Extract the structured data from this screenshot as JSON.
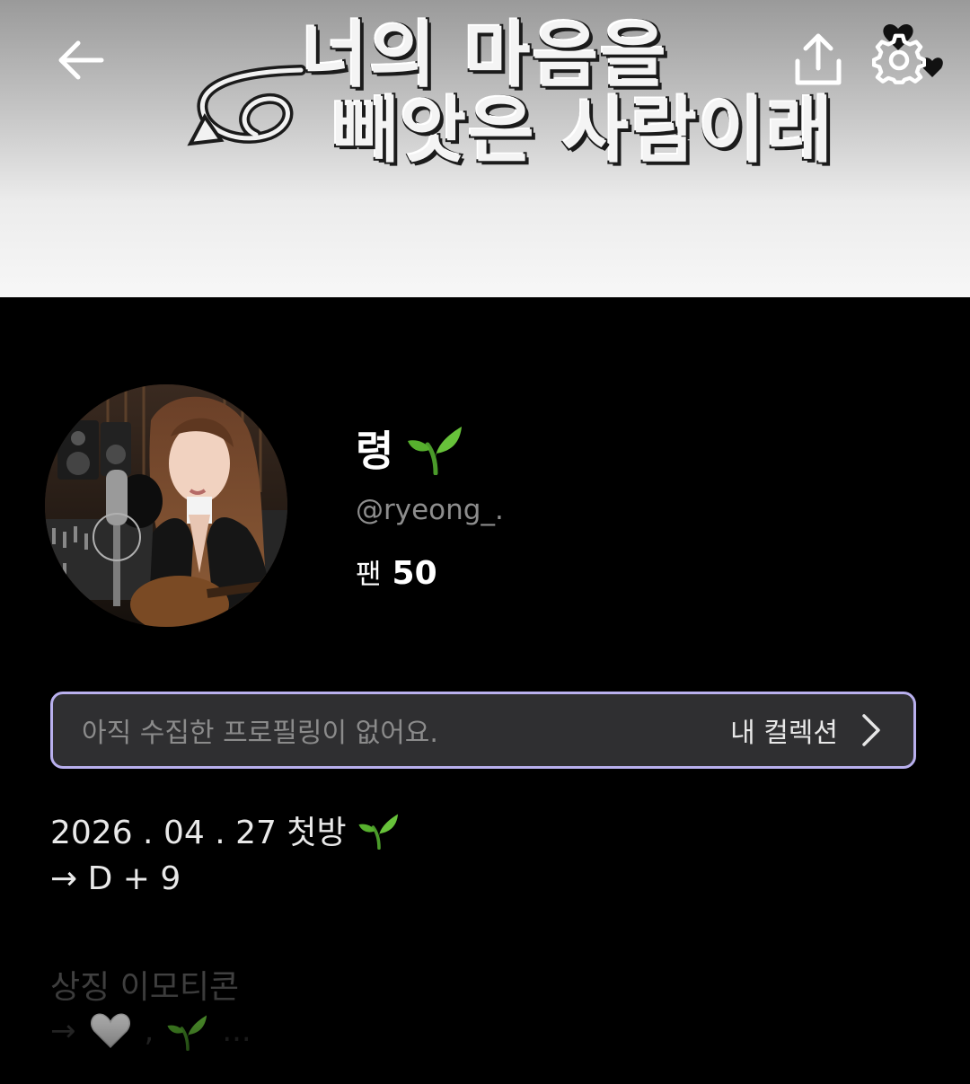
{
  "banner": {
    "line1": "너의 마음을",
    "line2": "빼앗은 사람이래"
  },
  "header": {
    "back_icon": "arrow-left-icon",
    "share_icon": "share-upload-icon",
    "settings_icon": "gear-icon"
  },
  "profile": {
    "name": "령",
    "name_emoji": "🌱",
    "handle": "@ryeong_.",
    "fans_label": "팬",
    "fans_count": "50"
  },
  "collection": {
    "empty_text": "아직 수집한 프로필링이 없어요.",
    "link_label": "내 컬렉션",
    "border_color": "#b9b0ee"
  },
  "bio": {
    "date_line": "2026 . 04 . 27 첫방",
    "date_emoji": "🌱",
    "dday_line": "→ D + 9",
    "symbol_title": "상징 이모티콘",
    "symbol_prefix": "→",
    "symbol_emojis": "🤍 , 🌱 ..."
  }
}
